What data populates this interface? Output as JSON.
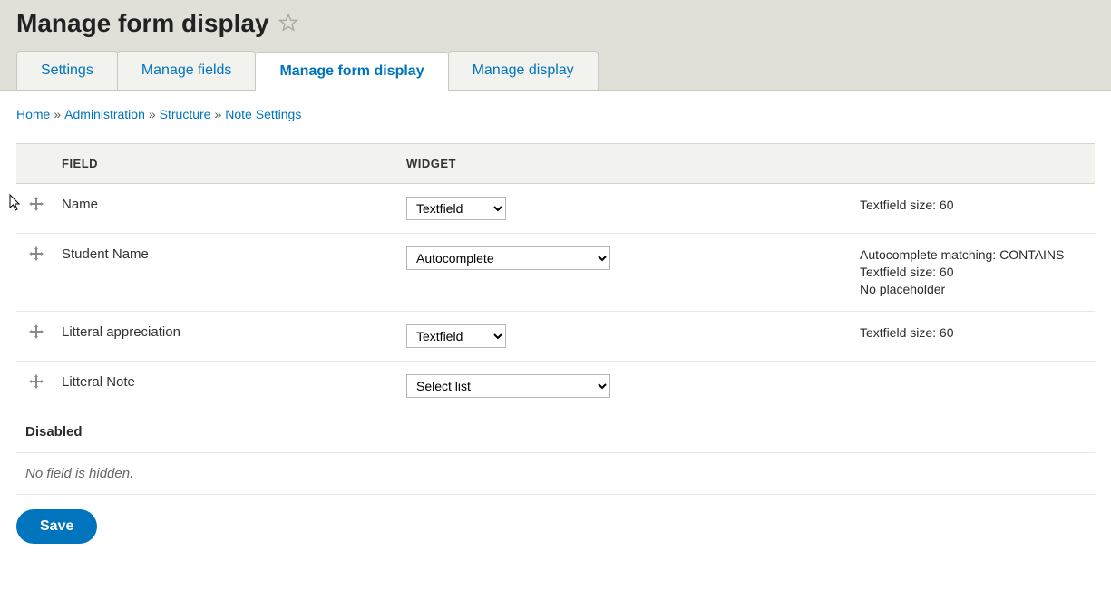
{
  "header": {
    "title": "Manage form display"
  },
  "tabs": [
    {
      "label": "Settings",
      "active": false
    },
    {
      "label": "Manage fields",
      "active": false
    },
    {
      "label": "Manage form display",
      "active": true
    },
    {
      "label": "Manage display",
      "active": false
    }
  ],
  "breadcrumb": {
    "items": [
      "Home",
      "Administration",
      "Structure",
      "Note Settings"
    ],
    "sep": "»"
  },
  "table": {
    "columns": {
      "field": "FIELD",
      "widget": "WIDGET"
    },
    "rows": [
      {
        "field": "Name",
        "widget": "Textfield",
        "wide": false,
        "summary": [
          "Textfield size: 60"
        ]
      },
      {
        "field": "Student Name",
        "widget": "Autocomplete",
        "wide": true,
        "summary": [
          "Autocomplete matching: CONTAINS",
          "Textfield size: 60",
          "No placeholder"
        ]
      },
      {
        "field": "Litteral appreciation",
        "widget": "Textfield",
        "wide": false,
        "summary": [
          "Textfield size: 60"
        ]
      },
      {
        "field": "Litteral Note",
        "widget": "Select list",
        "wide": true,
        "summary": []
      }
    ],
    "disabled_label": "Disabled",
    "disabled_empty": "No field is hidden."
  },
  "buttons": {
    "save": "Save"
  }
}
